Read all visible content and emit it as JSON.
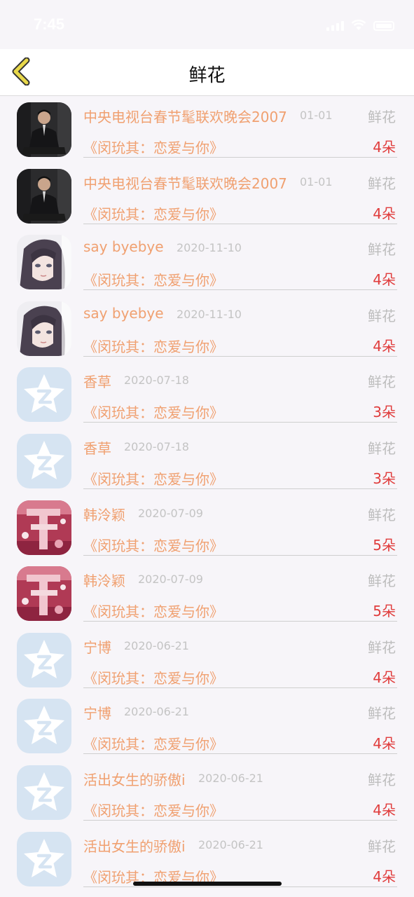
{
  "status": {
    "time": "7:45"
  },
  "nav": {
    "title": "鲜花"
  },
  "rows": [
    {
      "avatar": "photo-man",
      "name": "中央电视台春节髦联欢晚会2007",
      "date": "01-01",
      "gift_label": "鲜花",
      "song": "《闵玧其：恋爱与你》",
      "count": "4朵"
    },
    {
      "avatar": "photo-man",
      "name": "中央电视台春节髦联欢晚会2007",
      "date": "01-01",
      "gift_label": "鲜花",
      "song": "《闵玧其：恋爱与你》",
      "count": "4朵"
    },
    {
      "avatar": "anime-girl",
      "name": "say byebye",
      "date": "2020-11-10",
      "gift_label": "鲜花",
      "song": "《闵玧其：恋爱与你》",
      "count": "4朵"
    },
    {
      "avatar": "anime-girl",
      "name": "say byebye",
      "date": "2020-11-10",
      "gift_label": "鲜花",
      "song": "《闵玧其：恋爱与你》",
      "count": "4朵"
    },
    {
      "avatar": "default-star",
      "name": "香草",
      "date": "2020-07-18",
      "gift_label": "鲜花",
      "song": "《闵玧其：恋爱与你》",
      "count": "3朵"
    },
    {
      "avatar": "default-star",
      "name": "香草",
      "date": "2020-07-18",
      "gift_label": "鲜花",
      "song": "《闵玧其：恋爱与你》",
      "count": "3朵"
    },
    {
      "avatar": "pink-pattern",
      "name": "韩泠颖",
      "date": "2020-07-09",
      "gift_label": "鲜花",
      "song": "《闵玧其：恋爱与你》",
      "count": "5朵"
    },
    {
      "avatar": "pink-pattern",
      "name": "韩泠颖",
      "date": "2020-07-09",
      "gift_label": "鲜花",
      "song": "《闵玧其：恋爱与你》",
      "count": "5朵"
    },
    {
      "avatar": "default-star",
      "name": "宁博",
      "date": "2020-06-21",
      "gift_label": "鲜花",
      "song": "《闵玧其：恋爱与你》",
      "count": "4朵"
    },
    {
      "avatar": "default-star",
      "name": "宁博",
      "date": "2020-06-21",
      "gift_label": "鲜花",
      "song": "《闵玧其：恋爱与你》",
      "count": "4朵"
    },
    {
      "avatar": "default-star",
      "name": "活出女生的骄傲i",
      "date": "2020-06-21",
      "gift_label": "鲜花",
      "song": "《闵玧其：恋爱与你》",
      "count": "4朵"
    },
    {
      "avatar": "default-star",
      "name": "活出女生的骄傲i",
      "date": "2020-06-21",
      "gift_label": "鲜花",
      "song": "《闵玧其：恋爱与你》",
      "count": "4朵"
    }
  ],
  "colors": {
    "name": "#f0a070",
    "date": "#c4c4c4",
    "gift_label": "#bdbdbd",
    "count": "#e03c3c",
    "back_arrow": "#e8d84a",
    "background": "#f7f5f9"
  }
}
